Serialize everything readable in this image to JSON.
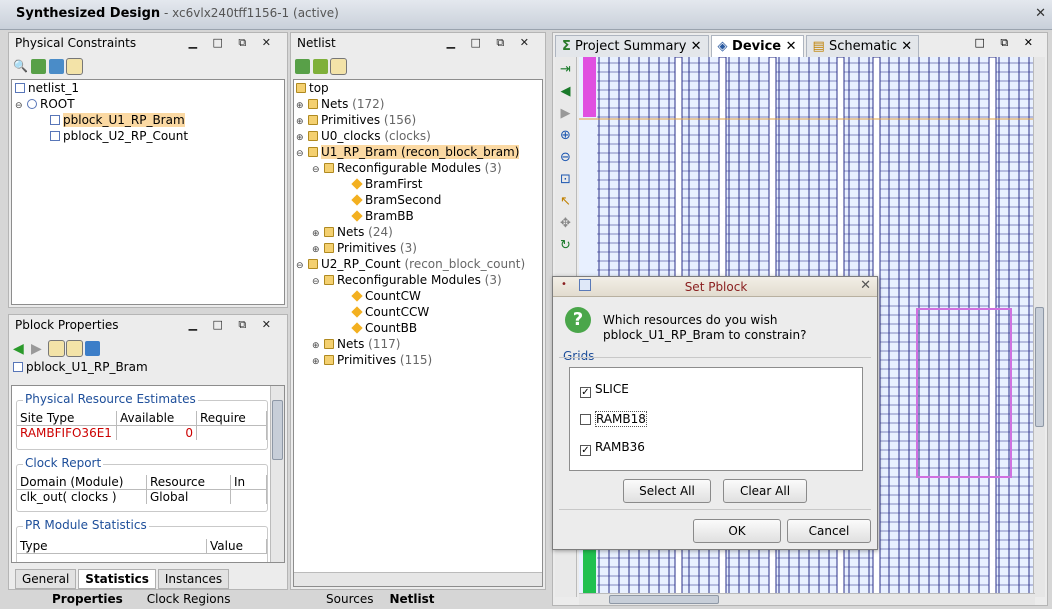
{
  "window": {
    "title": "Synthesized Design",
    "part": "xc6vlx240tff1156-1",
    "status": "(active)",
    "close": "✕"
  },
  "physical_constraints": {
    "title": "Physical Constraints",
    "tree": [
      {
        "label": "netlist_1"
      },
      {
        "label": "ROOT"
      },
      {
        "label": "pblock_U1_RP_Bram",
        "selected": true
      },
      {
        "label": "pblock_U2_RP_Count"
      }
    ]
  },
  "pblock_props": {
    "title": "Pblock Properties",
    "name": "pblock_U1_RP_Bram",
    "sections": {
      "resource": {
        "title": "Physical Resource Estimates",
        "headers": [
          "Site Type",
          "Available",
          "Require"
        ],
        "rows": [
          [
            "RAMBFIFO36E1",
            "0",
            ""
          ]
        ]
      },
      "clock": {
        "title": "Clock Report",
        "headers": [
          "Domain (Module)",
          "Resource",
          "In"
        ],
        "rows": [
          [
            "clk_out( clocks )",
            "Global",
            ""
          ]
        ]
      },
      "pr": {
        "title": "PR Module Statistics",
        "headers": [
          "Type",
          "Value"
        ]
      }
    },
    "tabs": [
      "General",
      "Statistics",
      "Instances"
    ],
    "active_tab": "Statistics"
  },
  "netlist": {
    "title": "Netlist",
    "root": "top",
    "items": [
      {
        "label": "Nets",
        "count": "(172)"
      },
      {
        "label": "Primitives",
        "count": "(156)"
      },
      {
        "label": "U0_clocks",
        "count": "(clocks)"
      },
      {
        "label": "U1_RP_Bram",
        "count": "(recon_block_bram)"
      },
      {
        "label": "Reconfigurable Modules",
        "count": "(3)"
      },
      {
        "label": "BramFirst",
        "count": ""
      },
      {
        "label": "BramSecond",
        "count": ""
      },
      {
        "label": "BramBB",
        "count": ""
      },
      {
        "label": "Nets",
        "count": "(24)"
      },
      {
        "label": "Primitives",
        "count": "(3)"
      },
      {
        "label": "U2_RP_Count",
        "count": "(recon_block_count)"
      },
      {
        "label": "Reconfigurable Modules",
        "count": "(3)"
      },
      {
        "label": "CountCW",
        "count": ""
      },
      {
        "label": "CountCCW",
        "count": ""
      },
      {
        "label": "CountBB",
        "count": ""
      },
      {
        "label": "Nets",
        "count": "(117)"
      },
      {
        "label": "Primitives",
        "count": "(115)"
      }
    ]
  },
  "bottom_tabs": {
    "left": [
      "Properties",
      "Clock Regions"
    ],
    "middle": [
      "Sources",
      "Netlist"
    ]
  },
  "device_tabs": [
    "Project Summary",
    "Device",
    "Schematic"
  ],
  "active_device_tab": "Device",
  "dialog": {
    "title": "Set Pblock",
    "question_line1": "Which resources do you wish",
    "question_line2": "pblock_U1_RP_Bram to constrain?",
    "grids_label": "Grids",
    "options": [
      {
        "label": "SLICE",
        "checked": true
      },
      {
        "label": "RAMB18",
        "checked": false
      },
      {
        "label": "RAMB36",
        "checked": true
      }
    ],
    "select_all": "Select All",
    "clear_all": "Clear All",
    "ok": "OK",
    "cancel": "Cancel"
  },
  "colors": {
    "accent": "#1d4e9a",
    "selection": "#fbd9a3",
    "grid": "#2a2f8a",
    "pblock": "#d070e0"
  }
}
